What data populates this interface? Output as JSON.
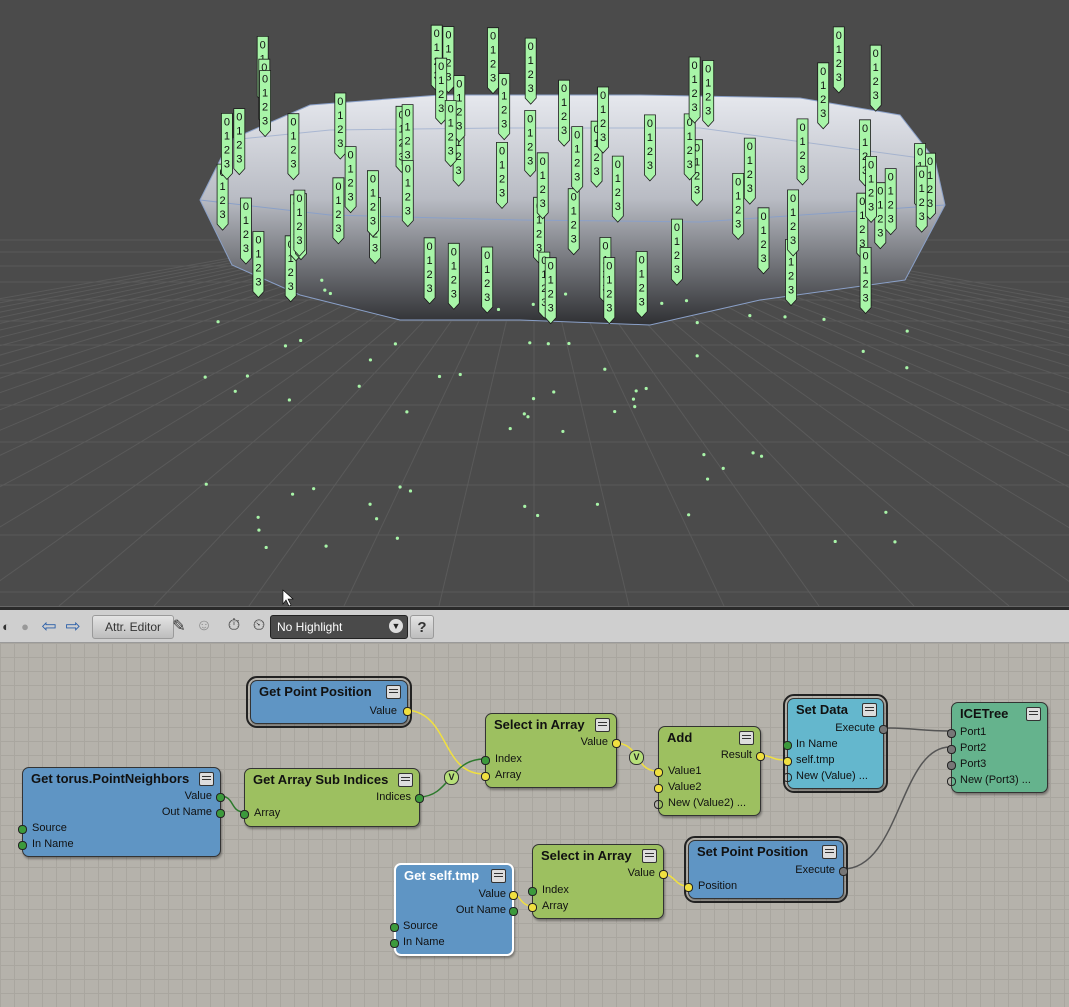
{
  "toolbar": {
    "attr_editor_label": "Attr. Editor",
    "highlight_value": "No Highlight",
    "help_label": "?"
  },
  "viewport": {
    "tag_digits": [
      "0",
      "1",
      "2",
      "3"
    ]
  },
  "nodes": {
    "get_point_position": {
      "title": "Get Point Position",
      "ports": [
        "Value"
      ]
    },
    "get_neighbors": {
      "title": "Get torus.PointNeighbors",
      "ports": [
        "Value",
        "Out Name",
        "Source",
        "In Name"
      ]
    },
    "get_array_sub_indices": {
      "title": "Get Array Sub Indices",
      "ports": [
        "Indices",
        "Array"
      ]
    },
    "select_in_array_1": {
      "title": "Select in Array",
      "ports": [
        "Value",
        "Index",
        "Array"
      ]
    },
    "add": {
      "title": "Add",
      "ports": [
        "Result",
        "Value1",
        "Value2",
        "New (Value2) ..."
      ]
    },
    "set_data": {
      "title": "Set Data",
      "ports": [
        "Execute",
        "In Name",
        "self.tmp",
        "New (Value) ..."
      ]
    },
    "ice_tree": {
      "title": "ICETree",
      "ports": [
        "Port1",
        "Port2",
        "Port3",
        "New (Port3) ..."
      ]
    },
    "get_self_tmp": {
      "title": "Get self.tmp",
      "ports": [
        "Value",
        "Out Name",
        "Source",
        "In Name"
      ]
    },
    "select_in_array_2": {
      "title": "Select in Array",
      "ports": [
        "Value",
        "Index",
        "Array"
      ]
    },
    "set_point_position": {
      "title": "Set Point Position",
      "ports": [
        "Execute",
        "Position"
      ]
    }
  },
  "converters": [
    "V",
    "V"
  ],
  "colors": {
    "node_blue": "#5f95c4",
    "node_green": "#9dc060",
    "node_cyan": "#64b7cd",
    "node_teal": "#65b38d",
    "tag_green": "#a8f5a8",
    "wire_yellow": "#f0e040",
    "wire_green": "#2d7a2d",
    "wire_gray": "#555555"
  }
}
